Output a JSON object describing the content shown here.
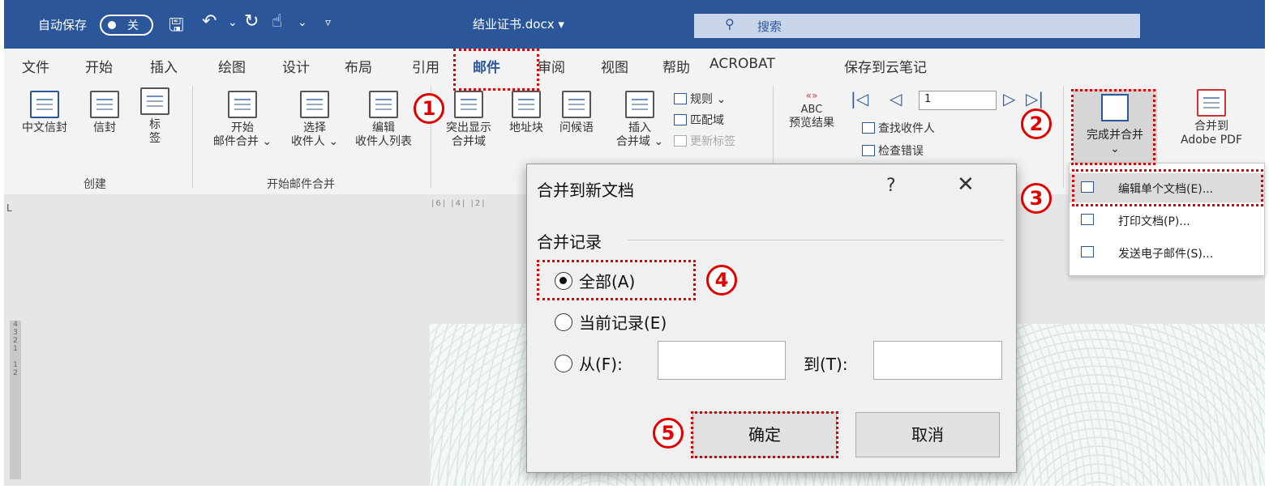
{
  "titlebar": {
    "autosave_label": "自动保存",
    "autosave_state": "关",
    "doc_title": "结业证书.docx ▾",
    "search_placeholder": "搜索"
  },
  "tabs": [
    "文件",
    "开始",
    "插入",
    "绘图",
    "设计",
    "布局",
    "引用",
    "邮件",
    "审阅",
    "视图",
    "帮助",
    "ACROBAT",
    "保存到云笔记"
  ],
  "ribbon": {
    "create": {
      "cn_envelope": "中文信封",
      "envelope": "信封",
      "label_a": "标",
      "label_b": "签",
      "group": "创建"
    },
    "start_merge": {
      "start_a": "开始",
      "start_b": "邮件合并 ⌄",
      "select_a": "选择",
      "select_b": "收件人 ⌄",
      "edit_a": "编辑",
      "edit_b": "收件人列表",
      "group": "开始邮件合并"
    },
    "fields": {
      "highlight_a": "突出显示",
      "highlight_b": "合并域",
      "address": "地址块",
      "greeting": "问候语",
      "insert_a": "插入",
      "insert_b": "合并域 ⌄",
      "rules": "规则 ⌄",
      "match": "匹配域",
      "update": "更新标签"
    },
    "preview": {
      "abc": "ABC",
      "preview": "预览结果",
      "find": "查找收件人",
      "check": "检查错误",
      "record": "1"
    },
    "finish": {
      "label": "完成并合并",
      "adobe_a": "合并到",
      "adobe_b": "Adobe PDF"
    }
  },
  "menu": {
    "edit_docs": "编辑单个文档(E)...",
    "print_docs": "打印文档(P)...",
    "send_email": "发送电子邮件(S)..."
  },
  "dialog": {
    "title": "合并到新文档",
    "help": "?",
    "close": "✕",
    "section": "合并记录",
    "all": "全部(A)",
    "current": "当前记录(E)",
    "from": "从(F):",
    "to": "到(T):",
    "from_value": "",
    "to_value": "",
    "ok": "确定",
    "cancel": "取消"
  },
  "annotations": [
    "1",
    "2",
    "3",
    "4",
    "5"
  ]
}
